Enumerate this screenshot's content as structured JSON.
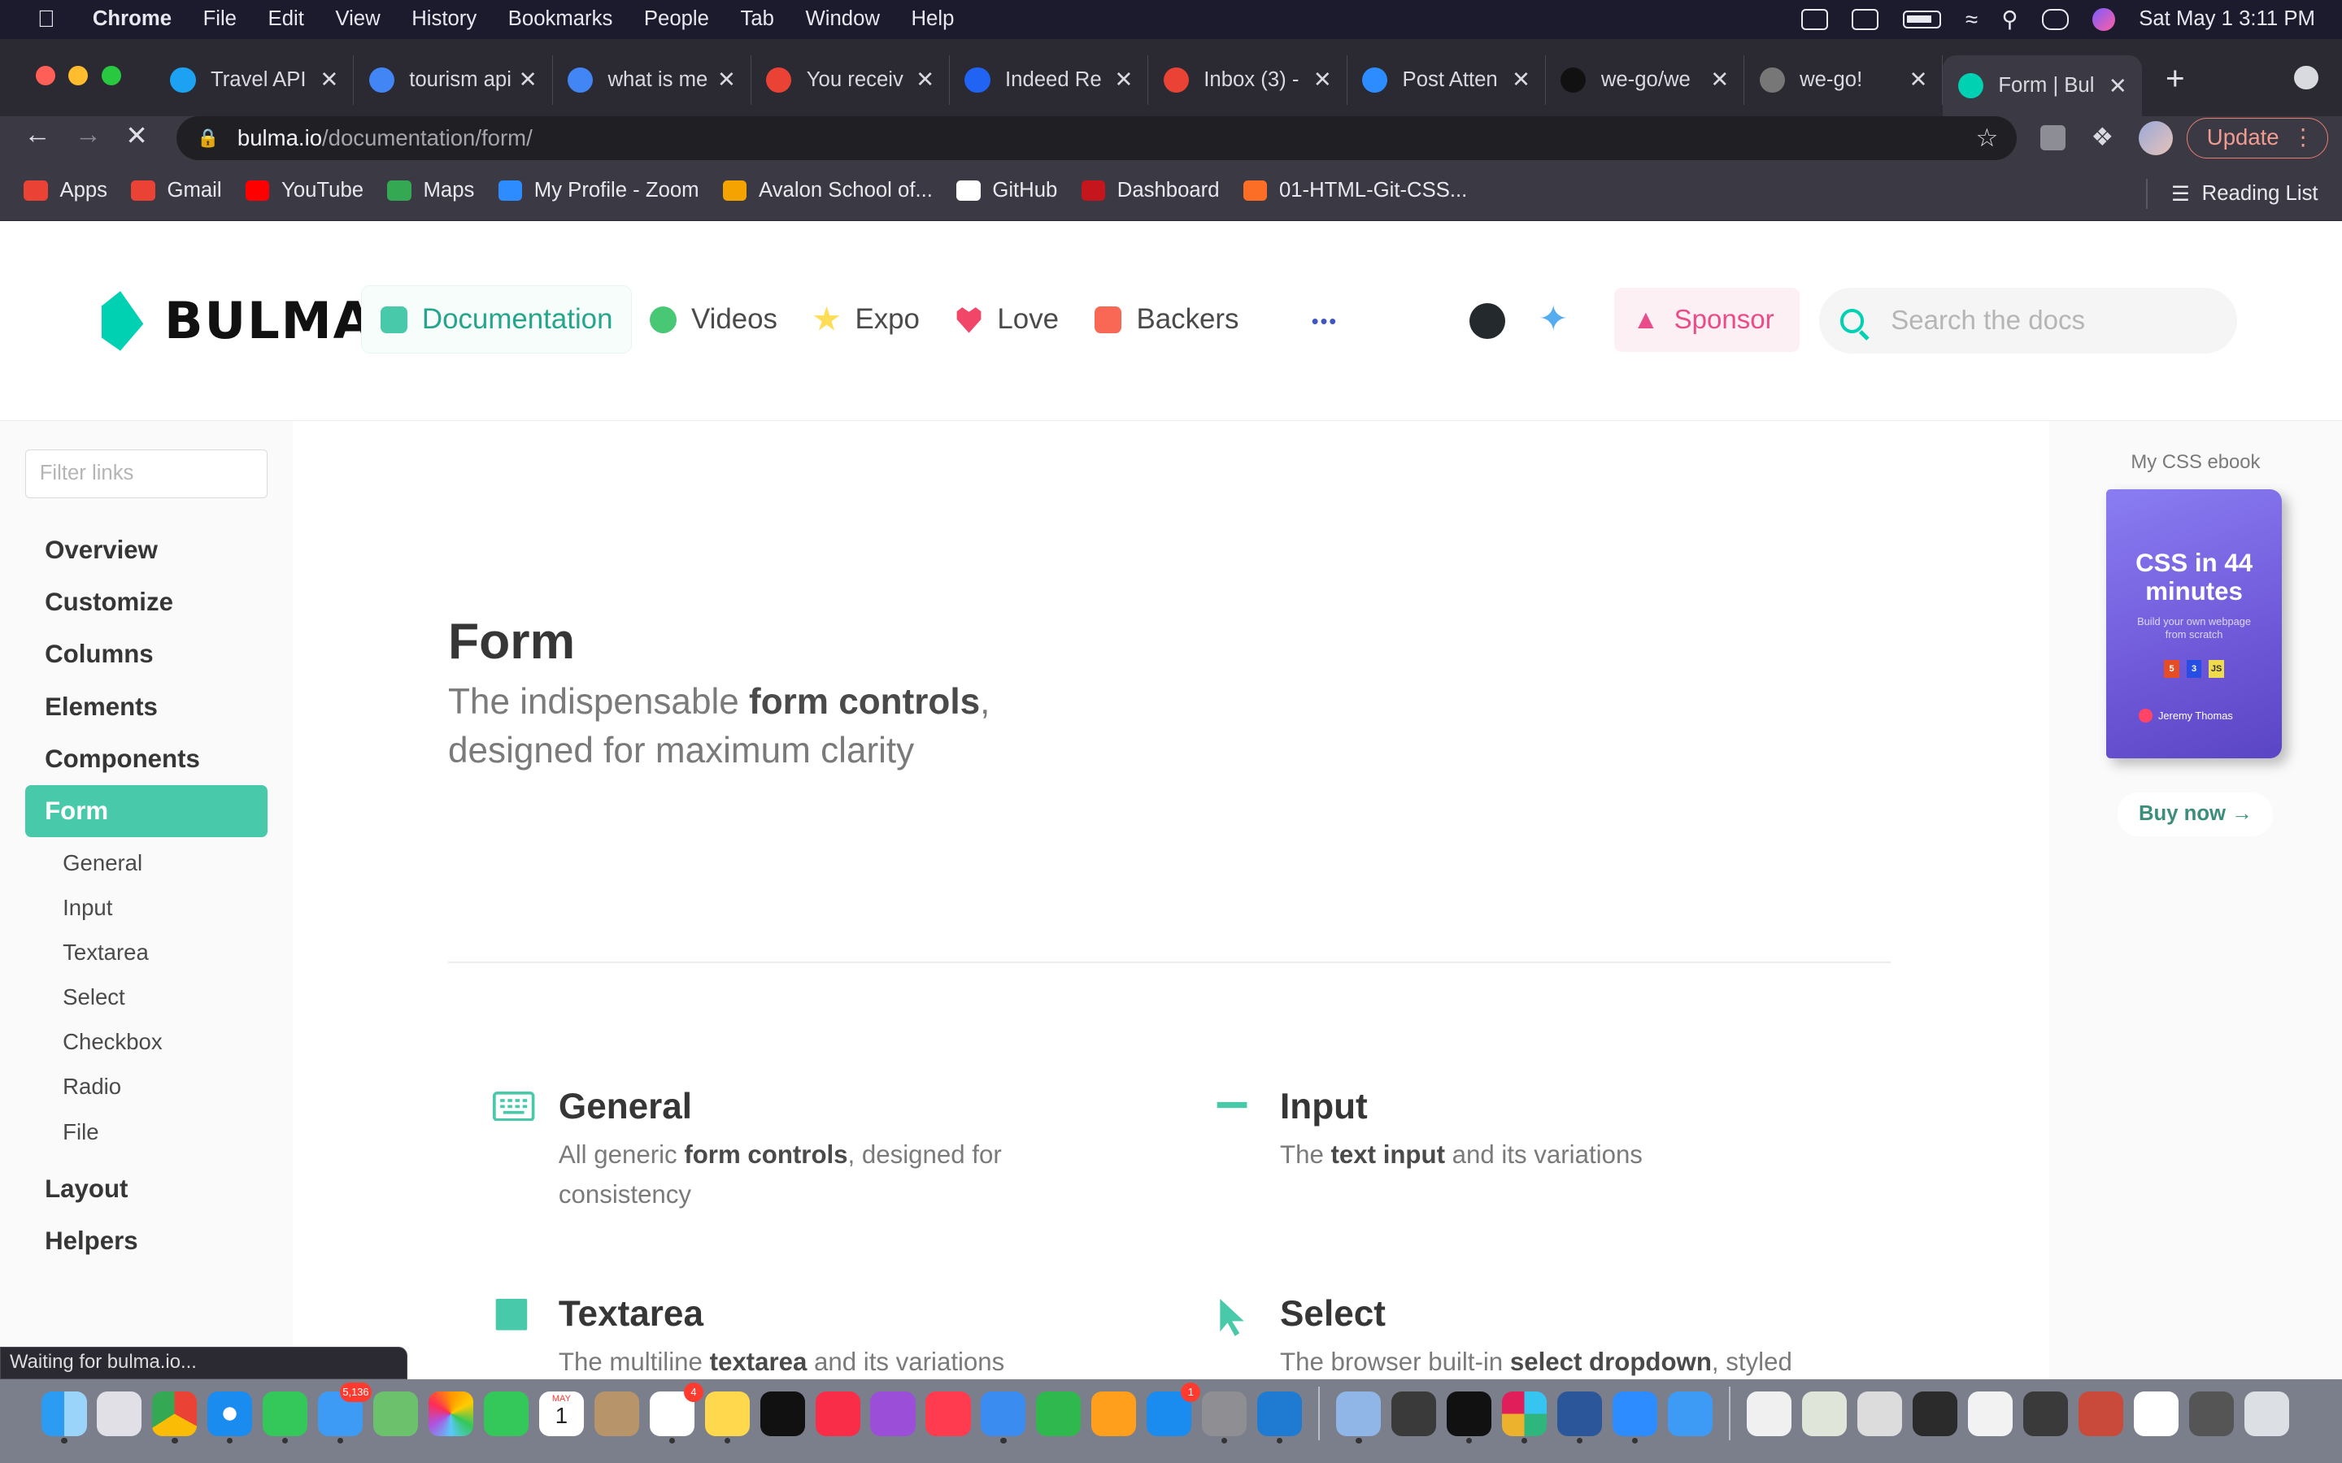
{
  "menubar": {
    "app": "Chrome",
    "items": [
      "File",
      "Edit",
      "View",
      "History",
      "Bookmarks",
      "People",
      "Tab",
      "Window",
      "Help"
    ],
    "clock": "Sat May 1  3:11 PM"
  },
  "tabs": [
    {
      "label": "Travel API",
      "icon_color": "#1da1f2"
    },
    {
      "label": "tourism api",
      "icon_color": "#4285f4"
    },
    {
      "label": "what is me",
      "icon_color": "#4285f4"
    },
    {
      "label": "You receiv",
      "icon_color": "#ea4335"
    },
    {
      "label": "Indeed Re",
      "icon_color": "#2164f3"
    },
    {
      "label": "Inbox (3) -",
      "icon_color": "#ea4335"
    },
    {
      "label": "Post Atten",
      "icon_color": "#2d8cff"
    },
    {
      "label": "we-go/we",
      "icon_color": "#111111"
    },
    {
      "label": "we-go!",
      "icon_color": "#777777"
    },
    {
      "label": "Form | Bul",
      "icon_color": "#00d1b2",
      "active": true
    }
  ],
  "toolbar": {
    "url_host": "bulma.io",
    "url_path": "/documentation/form/",
    "update_label": "Update"
  },
  "bookmarks": [
    {
      "label": "Apps",
      "color": "#ea4335"
    },
    {
      "label": "Gmail",
      "color": "#ea4335"
    },
    {
      "label": "YouTube",
      "color": "#ff0000"
    },
    {
      "label": "Maps",
      "color": "#34a853"
    },
    {
      "label": "My Profile - Zoom",
      "color": "#2d8cff"
    },
    {
      "label": "Avalon School of...",
      "color": "#f4a300"
    },
    {
      "label": "GitHub",
      "color": "#ffffff"
    },
    {
      "label": "Dashboard",
      "color": "#c4161c"
    },
    {
      "label": "01-HTML-Git-CSS...",
      "color": "#fc6d26"
    }
  ],
  "reading_list": "Reading List",
  "site": {
    "brand": "BULMA",
    "nav": [
      {
        "label": "Documentation",
        "icon_color": "#48c9a9",
        "active": true
      },
      {
        "label": "Videos",
        "icon_color": "#48c774"
      },
      {
        "label": "Expo",
        "icon_color": "#ffdd57"
      },
      {
        "label": "Love",
        "icon_color": "#f14668"
      },
      {
        "label": "Backers",
        "icon_color": "#f96854"
      }
    ],
    "more": "•••",
    "sponsor": "Sponsor",
    "search_placeholder": "Search the docs"
  },
  "sidebar": {
    "filter_placeholder": "Filter links",
    "items": [
      "Overview",
      "Customize",
      "Columns",
      "Elements",
      "Components"
    ],
    "active": "Form",
    "subitems": [
      "General",
      "Input",
      "Textarea",
      "Select",
      "Checkbox",
      "Radio",
      "File"
    ],
    "items_after": [
      "Layout",
      "Helpers"
    ]
  },
  "main": {
    "title": "Form",
    "subtitle_pre": "The indispensable ",
    "subtitle_bold": "form controls",
    "subtitle_post": ", designed for maximum clarity",
    "cards": [
      {
        "title": "General",
        "pre": "All generic ",
        "bold": "form controls",
        "post": ", designed for consistency"
      },
      {
        "title": "Input",
        "pre": "The ",
        "bold": "text input",
        "post": " and its variations"
      },
      {
        "title": "Textarea",
        "pre": "The multiline ",
        "bold": "textarea",
        "post": " and its variations"
      },
      {
        "title": "Select",
        "pre": "The browser built-in ",
        "bold": "select dropdown",
        "post": ", styled"
      }
    ]
  },
  "ad": {
    "label": "My CSS ebook",
    "book_title": "CSS in 44 minutes",
    "book_sub": "Build your own webpage from scratch",
    "badges": [
      "5",
      "3",
      "JS"
    ],
    "author": "Jeremy Thomas",
    "buy": "Buy now →"
  },
  "status": "Waiting for bulma.io...",
  "dock": {
    "mail_badge": "5,136",
    "reminders_badge": "4",
    "appstore_badge": "1",
    "calendar_month": "MAY",
    "calendar_day": "1"
  }
}
